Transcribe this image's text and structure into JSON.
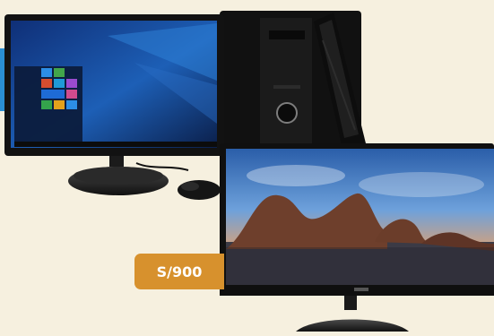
{
  "price_tag": {
    "label": "S/900"
  },
  "colors": {
    "background": "#f6f0df",
    "price_tag": "#d7912d",
    "blue_tab": "#2a8fd2",
    "monitor_frame": "#121212",
    "desktop_blue": "#1d5fb6",
    "sky_blue": "#2f6fbf",
    "sunset_orange": "#e89a58"
  },
  "icons": [
    "desktop-monitor-icon",
    "pc-tower-icon",
    "keyboard-icon",
    "mouse-icon",
    "tv-monitor-icon"
  ]
}
